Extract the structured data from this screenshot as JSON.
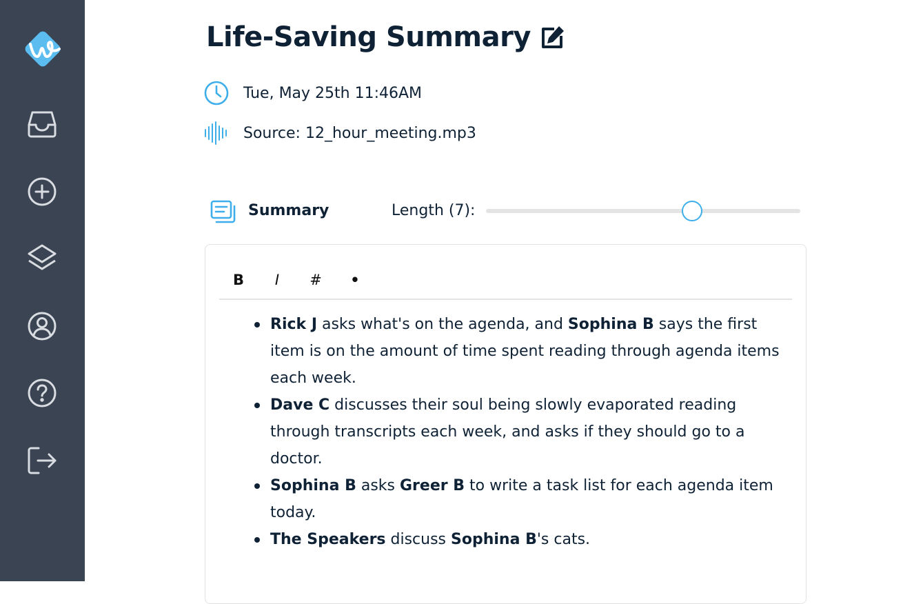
{
  "colors": {
    "sidebar_bg": "#3a4452",
    "accent": "#3daee9",
    "text_dark": "#0f2235"
  },
  "sidebar": {
    "logo_icon": "w-logo-icon",
    "items": [
      {
        "icon": "inbox-icon"
      },
      {
        "icon": "plus-circle-icon"
      },
      {
        "icon": "layers-icon"
      },
      {
        "icon": "user-circle-icon"
      },
      {
        "icon": "help-circle-icon"
      },
      {
        "icon": "logout-icon"
      }
    ]
  },
  "header": {
    "title": "Life-Saving Summary",
    "edit_icon": "edit-icon"
  },
  "meta": {
    "datetime": "Tue, May 25th 11:46AM",
    "source": "Source: 12_hour_meeting.mp3"
  },
  "summary_bar": {
    "label": "Summary",
    "length_label": "Length (7):",
    "length_value": 7,
    "slider_fraction": 0.655
  },
  "toolbar": {
    "bold": "B",
    "italic": "I",
    "heading": "#",
    "bullet": "•"
  },
  "summary_items": [
    [
      {
        "text": "Rick J",
        "bold": true
      },
      {
        "text": " asks what's on the agenda, and ",
        "bold": false
      },
      {
        "text": "Sophina B",
        "bold": true
      },
      {
        "text": " says the first item is on the amount of time spent reading through agenda items each week.",
        "bold": false
      }
    ],
    [
      {
        "text": "Dave C",
        "bold": true
      },
      {
        "text": " discusses their soul being slowly evaporated reading through transcripts each week, and asks if they should go to a doctor.",
        "bold": false
      }
    ],
    [
      {
        "text": "Sophina B",
        "bold": true
      },
      {
        "text": " asks ",
        "bold": false
      },
      {
        "text": "Greer B",
        "bold": true
      },
      {
        "text": " to write a task list for each agenda item today.",
        "bold": false
      }
    ],
    [
      {
        "text": "The Speakers",
        "bold": true
      },
      {
        "text": " discuss ",
        "bold": false
      },
      {
        "text": "Sophina B",
        "bold": true
      },
      {
        "text": "'s cats.",
        "bold": false
      }
    ]
  ]
}
